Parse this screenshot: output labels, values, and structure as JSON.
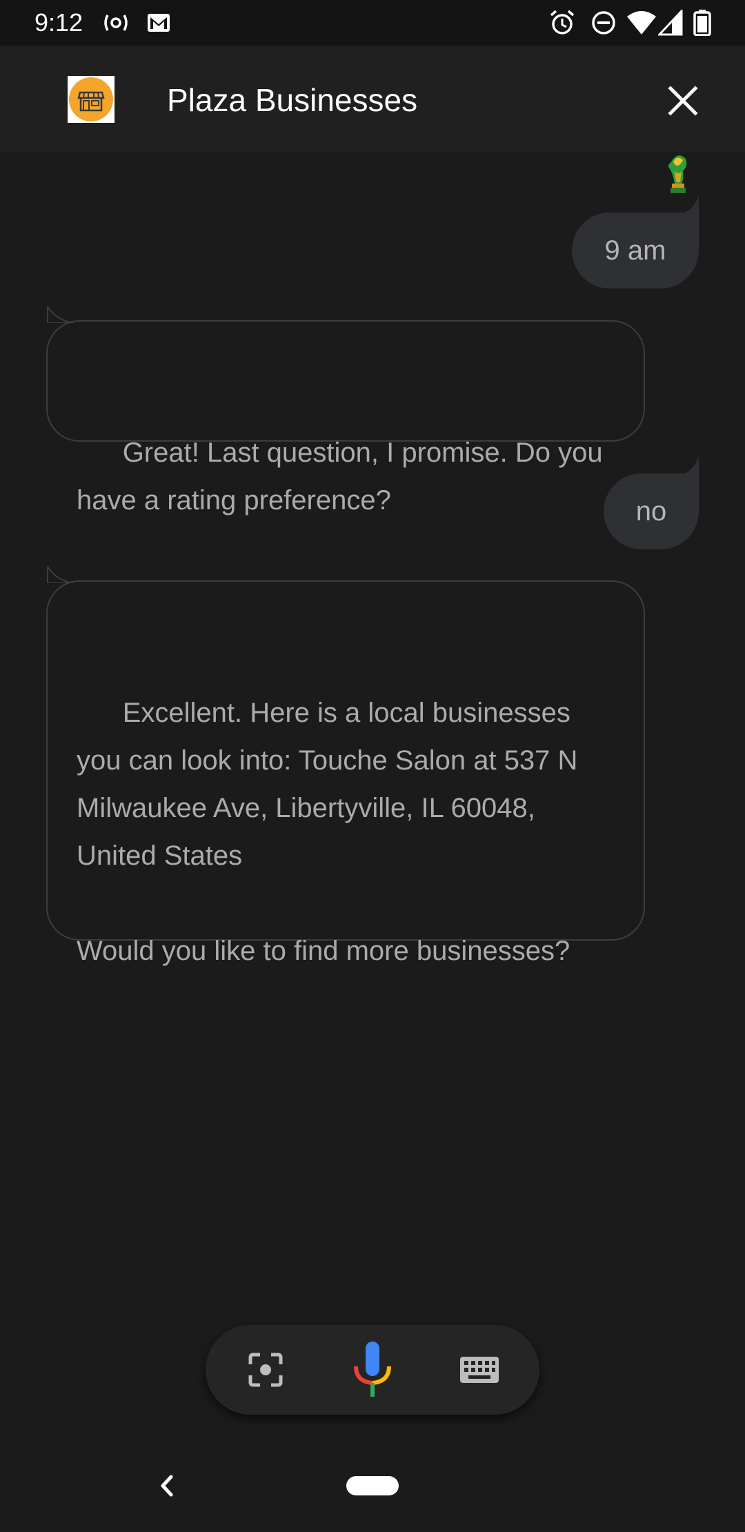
{
  "status_bar": {
    "time": "9:12"
  },
  "header": {
    "title": "Plaza Businesses"
  },
  "messages": [
    {
      "sender": "user",
      "text": "9 am"
    },
    {
      "sender": "bot",
      "text": "Great! Last question, I promise. Do you have a rating preference?"
    },
    {
      "sender": "user",
      "text": "no"
    },
    {
      "sender": "bot",
      "text": "Excellent. Here is a local businesses you can look into: Touche Salon at 537 N Milwaukee Ave, Libertyville, IL 60048, United States\n\nWould you like to find more businesses?"
    }
  ],
  "icons": {
    "status": [
      "radio-hotspot-icon",
      "gmail-icon",
      "alarm-icon",
      "do-not-disturb-icon",
      "wifi-icon",
      "cell-signal-icon",
      "battery-icon"
    ],
    "header": [
      "store-logo-icon",
      "close-icon"
    ],
    "input_bar": [
      "lens-icon",
      "microphone-icon",
      "keyboard-icon"
    ],
    "nav": [
      "back-icon",
      "home-pill"
    ]
  },
  "colors": {
    "background": "#1b1b1b",
    "header": "#202020",
    "user_bubble": "#2f3033",
    "logo": "#f4a52c",
    "mic_blue": "#4285f4",
    "mic_red": "#ea4335",
    "mic_yellow": "#fbbc04",
    "mic_green": "#34a853"
  }
}
